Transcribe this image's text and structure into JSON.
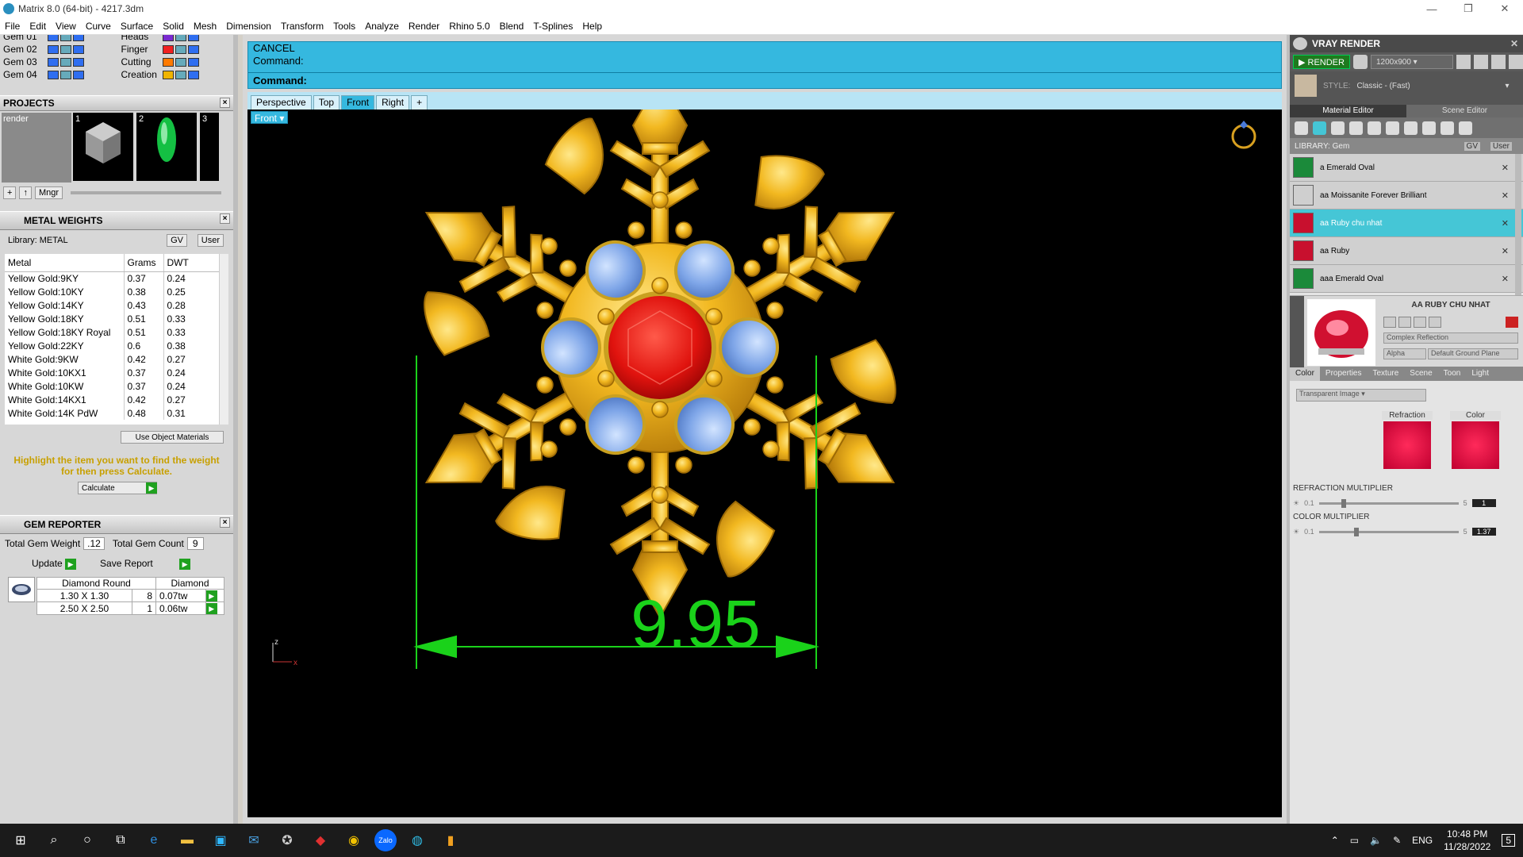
{
  "window": {
    "title": "Matrix 8.0 (64-bit) - 4217.3dm"
  },
  "menu": [
    "File",
    "Edit",
    "View",
    "Curve",
    "Surface",
    "Solid",
    "Mesh",
    "Dimension",
    "Transform",
    "Tools",
    "Analyze",
    "Render",
    "Rhino 5.0",
    "Blend",
    "T-Splines",
    "Help"
  ],
  "layers": {
    "left": [
      "Gem 01",
      "Gem 02",
      "Gem 03",
      "Gem 04"
    ],
    "right": [
      "Heads",
      "Finger",
      "Cutting",
      "Creation"
    ],
    "right_colors": [
      "#7a2ad0",
      "#f02020",
      "#ff7a00",
      "#f0b400"
    ]
  },
  "projects": {
    "title": "PROJECTS",
    "item": "render",
    "thumbs": [
      "1",
      "2",
      "3"
    ],
    "mgr_label": "Mngr"
  },
  "metal": {
    "title": "METAL WEIGHTS",
    "library": "Library: METAL",
    "gv": "GV",
    "user": "User",
    "columns": [
      "Metal",
      "Grams",
      "DWT"
    ],
    "rows": [
      [
        "Yellow Gold:9KY",
        "0.37",
        "0.24"
      ],
      [
        "Yellow Gold:10KY",
        "0.38",
        "0.25"
      ],
      [
        "Yellow Gold:14KY",
        "0.43",
        "0.28"
      ],
      [
        "Yellow Gold:18KY",
        "0.51",
        "0.33"
      ],
      [
        "Yellow Gold:18KY Royal",
        "0.51",
        "0.33"
      ],
      [
        "Yellow Gold:22KY",
        "0.6",
        "0.38"
      ],
      [
        "White Gold:9KW",
        "0.42",
        "0.27"
      ],
      [
        "White Gold:10KX1",
        "0.37",
        "0.24"
      ],
      [
        "White Gold:10KW",
        "0.37",
        "0.24"
      ],
      [
        "White Gold:14KX1",
        "0.42",
        "0.27"
      ],
      [
        "White Gold:14K PdW",
        "0.48",
        "0.31"
      ]
    ],
    "use_object": "Use Object Materials",
    "hint": "Highlight the item you want to find the weight for then press Calculate.",
    "calculate": "Calculate"
  },
  "gem_reporter": {
    "title": "GEM REPORTER",
    "total_weight_label": "Total Gem Weight",
    "total_weight": ".12",
    "total_count_label": "Total Gem Count",
    "total_count": "9",
    "update": "Update",
    "save": "Save Report",
    "col_headers": [
      "Diamond Round",
      "Diamond"
    ],
    "rows": [
      {
        "size": "1.30 X 1.30",
        "count": "8",
        "weight": "0.07tw"
      },
      {
        "size": "2.50 X 2.50",
        "count": "1",
        "weight": "0.06tw"
      }
    ]
  },
  "command": {
    "line1": "CANCEL",
    "line2": "Command:",
    "prompt": "Command:"
  },
  "viewtabs": [
    "Perspective",
    "Top",
    "Front",
    "Right",
    "+"
  ],
  "active_tab": "Front",
  "viewport": {
    "label": "Front",
    "dimension": "9.95",
    "axis_z": "z",
    "axis_x": "x"
  },
  "vray": {
    "title": "VRAY RENDER",
    "render": "RENDER",
    "resolution": "1200x900",
    "style_label": "STYLE:",
    "style_value": "Classic - (Fast)",
    "tabs": [
      "Material Editor",
      "Scene Editor"
    ],
    "library": "LIBRARY: Gem",
    "gv": "GV",
    "user": "User",
    "materials": [
      {
        "name": "a Emerald Oval",
        "color": "#1b8a3a"
      },
      {
        "name": "aa Moissanite Forever Brilliant",
        "color": "#cfcfcf"
      },
      {
        "name": "aa Ruby chu nhat",
        "color": "#c8102e",
        "selected": true
      },
      {
        "name": "aa Ruby",
        "color": "#c8102e"
      },
      {
        "name": "aaa Emerald Oval",
        "color": "#1b8a3a"
      }
    ],
    "preview_title": "AA RUBY CHU NHAT",
    "reflection": "Complex Reflection",
    "alpha": "Alpha",
    "ground": "Default Ground Plane",
    "prop_tabs": [
      "Color",
      "Properties",
      "Texture",
      "Scene",
      "Toon",
      "Light"
    ],
    "transparent": "Transparent Image",
    "refraction_label": "Refraction",
    "color_label": "Color",
    "refr_mult_label": "REFRACTION MULTIPLIER",
    "refr_min": "0.1",
    "refr_max": "5",
    "refr_value": "1",
    "col_mult_label": "COLOR MULTIPLIER",
    "col_min": "0.1",
    "col_max": "5",
    "col_value": "1.37"
  },
  "taskbar": {
    "lang": "ENG",
    "time": "10:48 PM",
    "date": "11/28/2022",
    "notif": "5",
    "zalo": "Zalo"
  }
}
